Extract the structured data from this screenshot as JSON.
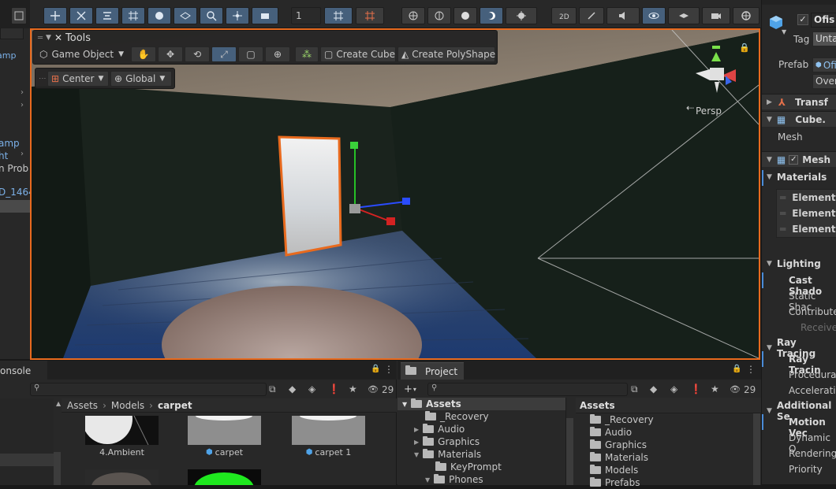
{
  "top_toolbar": {
    "layer_value": "1"
  },
  "scene_overlay": {
    "tools_title": "Tools",
    "context_label": "Game Object",
    "create_cube_label": "Create Cube",
    "create_polyshape_label": "Create PolyShape",
    "pivot_label": "Center",
    "space_label": "Global",
    "persp_label": "Persp"
  },
  "hierarchy": {
    "items": [
      "amp",
      "ht",
      "n Prob",
      "D_1464"
    ]
  },
  "inspector": {
    "object_name": "Ofis",
    "tag_label": "Tag",
    "tag_value": "Unta",
    "prefab_label": "Prefab",
    "prefab_value": "Ofi",
    "overrides_label": "Over",
    "transform_label": "Transf",
    "meshfilter_label": "Cube.",
    "mesh_label": "Mesh",
    "meshrenderer_label": "Mesh",
    "materials_label": "Materials",
    "elements": [
      "Element",
      "Element",
      "Element"
    ],
    "lighting_label": "Lighting",
    "lighting_rows": [
      "Cast Shado",
      "Static Shac",
      "Contribute",
      "Receive"
    ],
    "raytracing_label": "Ray Tracing",
    "raytracing_rows": [
      "Ray Tracin",
      "Procedural",
      "Accelerati"
    ],
    "additional_label": "Additional Se",
    "additional_rows": [
      "Motion Vec",
      "Dynamic O",
      "Rendering",
      "Priority"
    ]
  },
  "console": {
    "tab_label": "onsole",
    "breadcrumb": [
      "Assets",
      "Models",
      "carpet"
    ],
    "thumbs": [
      {
        "label": "4.Ambient"
      },
      {
        "label": "carpet"
      },
      {
        "label": "carpet 1"
      }
    ],
    "count": "29"
  },
  "project": {
    "tab_label": "Project",
    "count": "29",
    "tree_root": "Assets",
    "tree": [
      "_Recovery",
      "Audio",
      "Graphics",
      "Materials",
      "KeyPrompt",
      "Phones"
    ],
    "list_header": "Assets",
    "list": [
      "_Recovery",
      "Audio",
      "Graphics",
      "Materials",
      "Models",
      "Prefabs"
    ]
  },
  "colors": {
    "selection_outline": "#e86a1e",
    "active_button": "#46607c",
    "panel_bg": "#282828"
  }
}
